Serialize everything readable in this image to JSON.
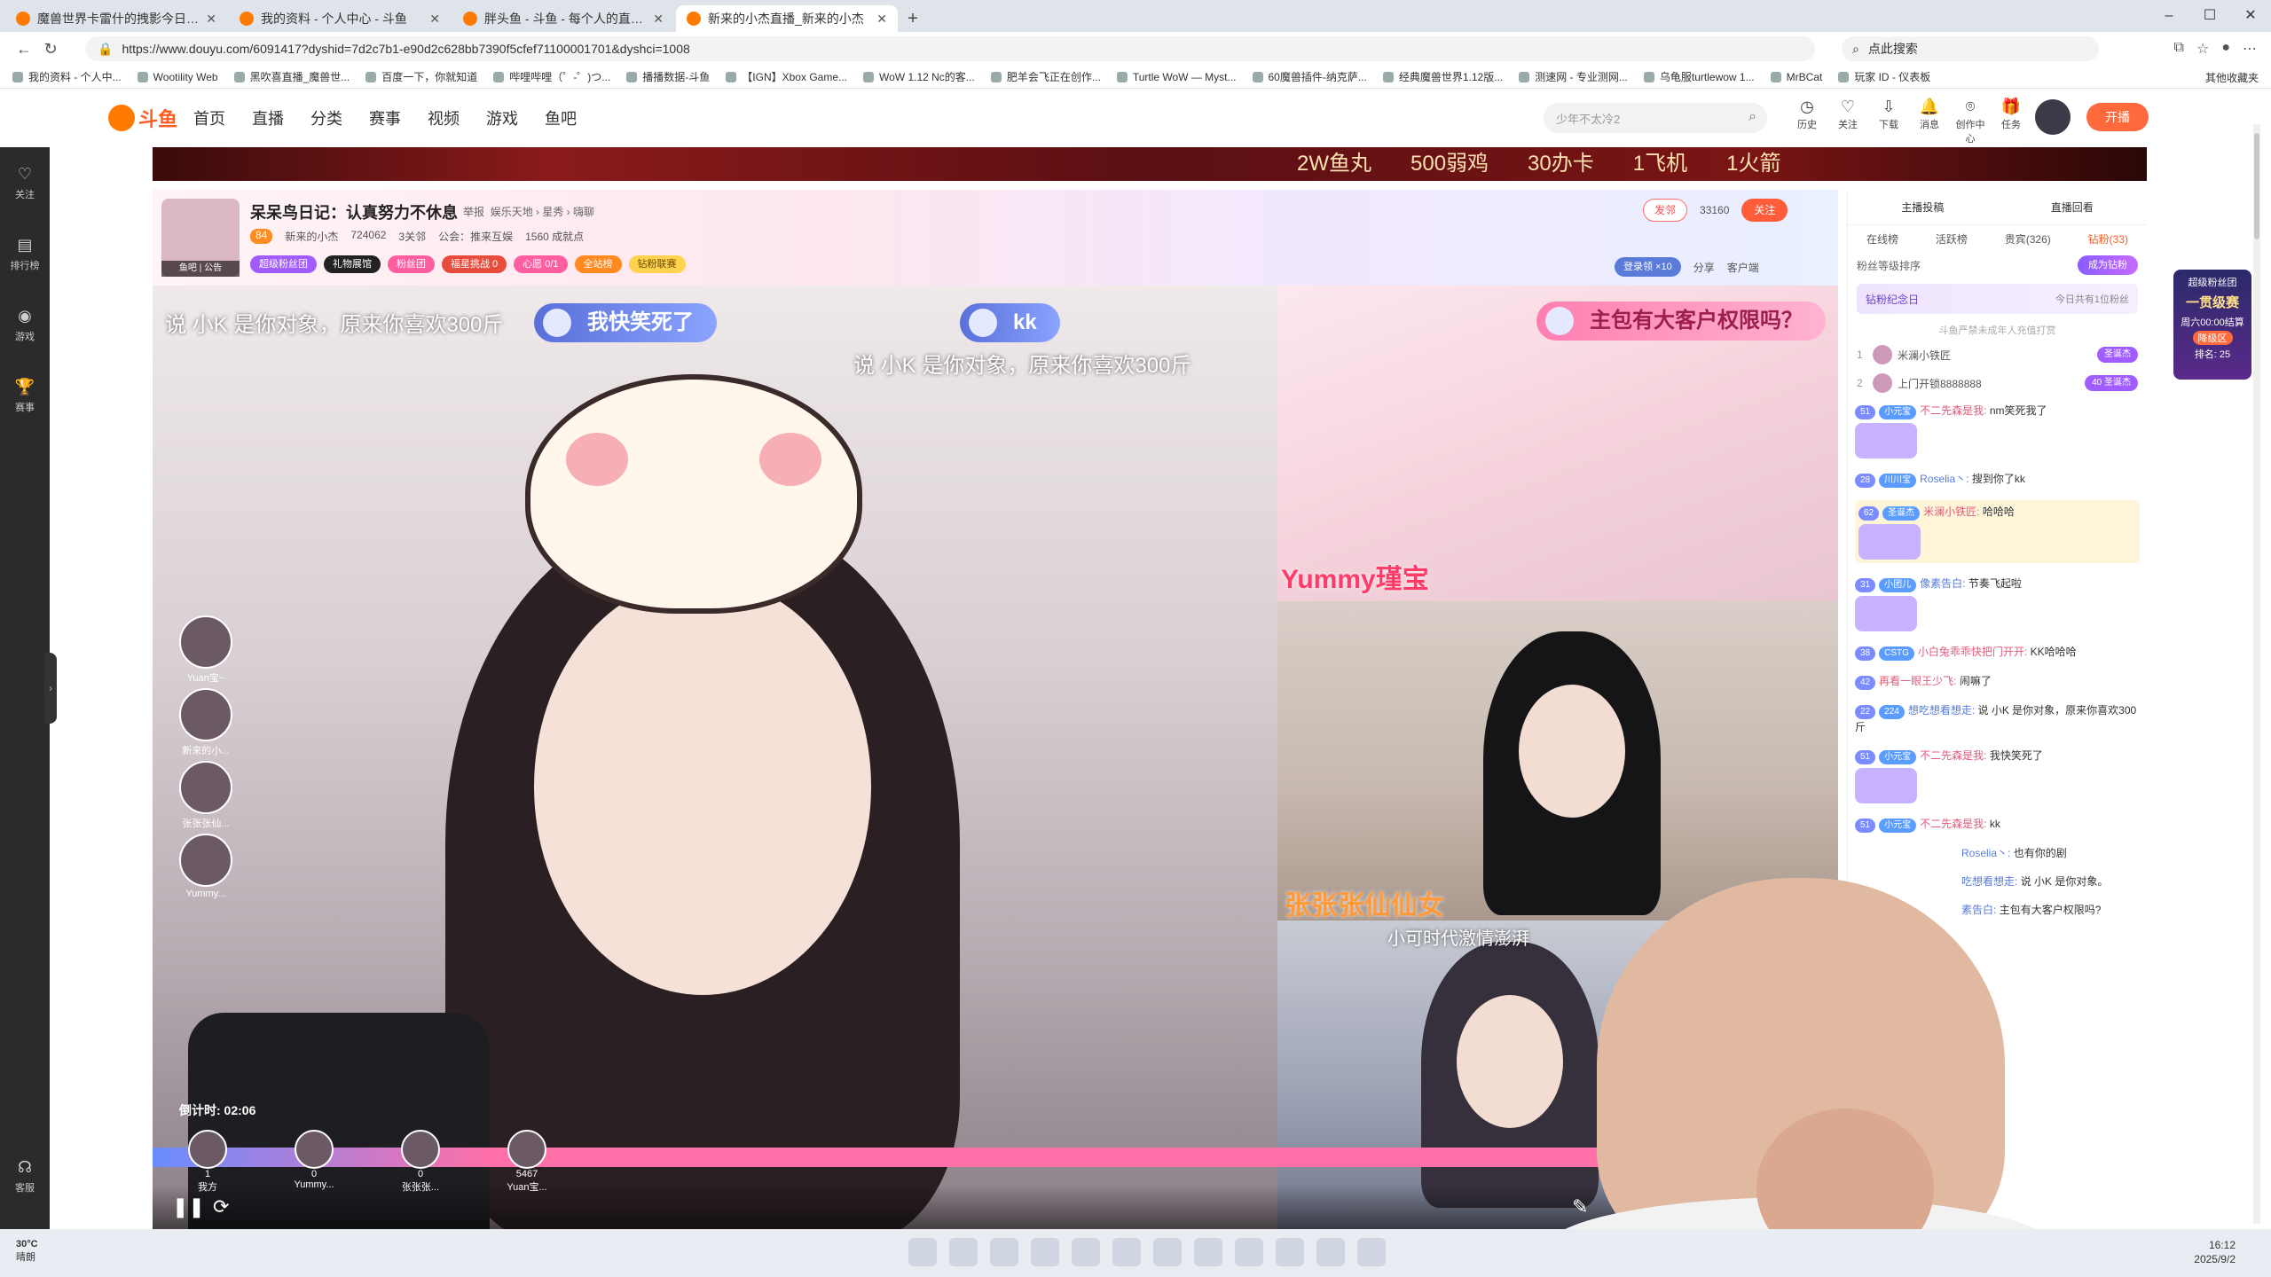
{
  "browser": {
    "tabs": [
      {
        "title": "魔兽世界卡雷什的拽影今日上线"
      },
      {
        "title": "我的资料 - 个人中心 - 斗鱼"
      },
      {
        "title": "胖头鱼 - 斗鱼 - 每个人的直播平台"
      },
      {
        "title": "新来的小杰直播_新来的小杰"
      }
    ],
    "url": "https://www.douyu.com/6091417?dyshid=7d2c7b1-e90d2c628bb7390f5cfef71100001701&dyshci=1008",
    "search_placeholder": "点此搜索",
    "bookmarks": [
      "我的资料 - 个人中...",
      "Wootility Web",
      "黑吹喜直播_魔兽世...",
      "百度一下，你就知道",
      "哔哩哔哩（゜-゜)つ...",
      "播播数据-斗鱼",
      "【IGN】Xbox Game...",
      "WoW 1.12 Nc的客...",
      "肥羊会飞正在创作...",
      "Turtle WoW — Myst...",
      "60魔兽插件-纳克萨...",
      "经典魔兽世界1.12版...",
      "测速网 - 专业测网...",
      "乌龟服turtlewow 1...",
      "MrBCat",
      "玩家 ID - 仪表板"
    ],
    "bookmarks_other": "其他收藏夹"
  },
  "site": {
    "logo": "斗鱼",
    "nav": [
      "首页",
      "直播",
      "分类",
      "赛事",
      "视频",
      "游戏",
      "鱼吧"
    ],
    "search_placeholder": "少年不太冷2",
    "header_icons": [
      "历史",
      "关注",
      "下载",
      "消息",
      "创作中心",
      "任务"
    ],
    "open_label": "开播"
  },
  "left_sidebar": [
    "关注",
    "排行榜",
    "游戏",
    "赛事"
  ],
  "left_sidebar_bottom": "客服",
  "banner": [
    "2W鱼丸",
    "500弱鸡",
    "30办卡",
    "1飞机",
    "1火箭"
  ],
  "room": {
    "avatar_tag": "鱼吧 | 公告",
    "title": "呆呆鸟日记：认真努力不休息",
    "report": "举报",
    "category": "娱乐天地 › 星秀 › 嗨聊",
    "level": "84",
    "streamer": "新来的小杰",
    "hot": "724062",
    "fans": "3关邻",
    "guild": "公会：推来互娱",
    "achievements": "1560 成就点",
    "badges": [
      "超级粉丝团",
      "礼物展馆",
      "粉丝团",
      "福星挑战 0",
      "心愿 0/1",
      "全站榜",
      "钻粉联赛"
    ],
    "fan_club": "发邻",
    "follow_count": "33160",
    "follow": "关注",
    "login_gift": "登录领 ×10",
    "share": "分享",
    "client": "客户端"
  },
  "video": {
    "overlay_left": "说 小K 是你对象，原来你喜欢300斤",
    "overlay_right": "说 小K 是你对象，原来你喜欢300斤",
    "bubble1": "我快笑死了",
    "bubble2": "kk",
    "bubble3": "主包有大客户权限吗？",
    "name_top_right": "Yummy瑾宝",
    "name_mid_right": "张张张仙仙女",
    "caption_bottom_right": "小可时代激情澎湃",
    "seats": [
      "Yuan宝~",
      "新来的小...",
      "张张张仙...",
      "Yummy..."
    ],
    "countdown": "倒计时: 02:06",
    "score_seats": [
      {
        "name": "我方",
        "score": "1"
      },
      {
        "name": "Yummy...",
        "score": "0"
      },
      {
        "name": "张张张...",
        "score": "0"
      },
      {
        "name": "Yuan宝...",
        "score": "5467"
      }
    ]
  },
  "panel": {
    "top": [
      "主播投稿",
      "直播回看"
    ],
    "tabs": [
      "在线榜",
      "活跃榜",
      "贵宾(326)",
      "钻粉(33)"
    ],
    "rank_label": "粉丝等级排序",
    "rank_btn": "成为钻粉",
    "memorial": "钻粉纪念日",
    "memorial_sub": "今日共有1位粉丝",
    "note": "斗鱼严禁未成年人充值打赏",
    "ranks": [
      {
        "n": "1",
        "name": "米澜小铁匠",
        "badge": "圣诞杰"
      },
      {
        "n": "2",
        "name": "上门开锁8888888",
        "badge": "40 圣诞杰"
      }
    ],
    "messages": [
      {
        "lv": "51",
        "fan": "小元宝",
        "user": "不二先森是我:",
        "text": "nm笑死我了"
      },
      {
        "lv": "28",
        "fan": "川川宝",
        "user": "Roselia丶:",
        "text": "搜到你了kk"
      },
      {
        "lv": "62",
        "fan": "圣诞杰",
        "user": "米澜小铁匠:",
        "text": "哈哈哈"
      },
      {
        "lv": "31",
        "fan": "小团儿",
        "user": "像素告白:",
        "text": "节奏飞起啦"
      },
      {
        "lv": "38",
        "fan": "CSTG",
        "user": "小白兔乖乖快把门开开:",
        "text": "KK哈哈哈"
      },
      {
        "lv": "42",
        "fan": "",
        "user": "再看一眼王少飞:",
        "text": "闹嘛了"
      },
      {
        "lv": "22",
        "fan": "224",
        "user": "想吃想看想走:",
        "text": "说 小K 是你对象，原来你喜欢300斤"
      },
      {
        "lv": "51",
        "fan": "小元宝",
        "user": "不二先森是我:",
        "text": "我快笑死了"
      },
      {
        "lv": "51",
        "fan": "小元宝",
        "user": "不二先森是我:",
        "text": "kk"
      },
      {
        "lv": "",
        "fan": "",
        "user": "Roselia丶:",
        "text": "也有你的剧"
      },
      {
        "lv": "",
        "fan": "",
        "user": "吃想看想走:",
        "text": "说 小K 是你对象。"
      },
      {
        "lv": "",
        "fan": "",
        "user": "素告白:",
        "text": "主包有大客户权限吗?"
      }
    ]
  },
  "fan_card": {
    "title": "超级粉丝团",
    "tier": "一贯级赛",
    "time": "周六00:00结算",
    "zone": "降级区",
    "rank": "排名: 25"
  },
  "taskbar": {
    "temp": "30°C",
    "weather": "晴朗",
    "time": "16:12",
    "date": "2025/9/2"
  }
}
